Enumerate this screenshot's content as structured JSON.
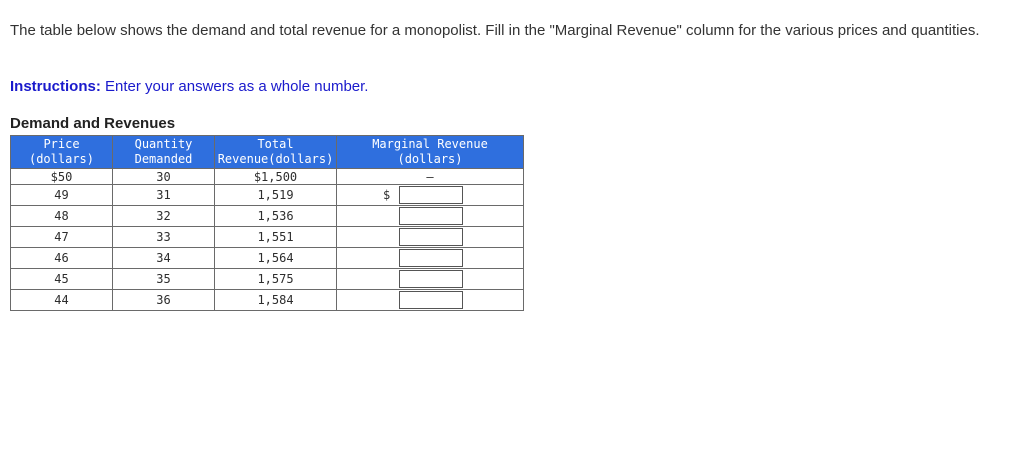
{
  "prompt": "The table below shows the demand and total revenue for a monopolist. Fill in the \"Marginal Revenue\" column for the various prices and quantities.",
  "instructions": {
    "label": "Instructions:",
    "text": " Enter your answers as a whole number."
  },
  "table": {
    "caption": "Demand and Revenues",
    "headers": {
      "price": [
        "Price",
        "(dollars)"
      ],
      "quantity": [
        "Quantity",
        "Demanded"
      ],
      "total_revenue": [
        "Total",
        "Revenue(dollars)"
      ],
      "marginal_revenue": [
        "Marginal Revenue",
        "(dollars)"
      ]
    },
    "first_row": {
      "price": "$50",
      "quantity": "30",
      "total_revenue": "$1,500",
      "marginal_revenue": "–"
    },
    "currency_symbol": "$",
    "rows": [
      {
        "price": "49",
        "quantity": "31",
        "total_revenue": "1,519",
        "marginal_revenue": ""
      },
      {
        "price": "48",
        "quantity": "32",
        "total_revenue": "1,536",
        "marginal_revenue": ""
      },
      {
        "price": "47",
        "quantity": "33",
        "total_revenue": "1,551",
        "marginal_revenue": ""
      },
      {
        "price": "46",
        "quantity": "34",
        "total_revenue": "1,564",
        "marginal_revenue": ""
      },
      {
        "price": "45",
        "quantity": "35",
        "total_revenue": "1,575",
        "marginal_revenue": ""
      },
      {
        "price": "44",
        "quantity": "36",
        "total_revenue": "1,584",
        "marginal_revenue": ""
      }
    ]
  },
  "colors": {
    "header_bg": "#2f6fde",
    "header_text": "#ffffff",
    "instructions": "#1a1acc"
  }
}
